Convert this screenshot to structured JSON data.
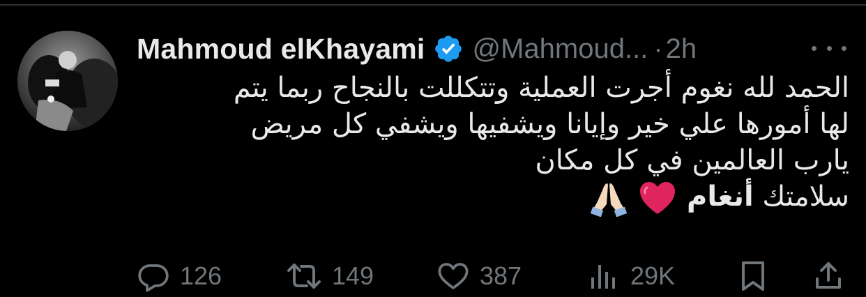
{
  "tweet": {
    "author": {
      "display_name": "Mahmoud elKhayami",
      "handle": "@Mahmoud...",
      "verified": true
    },
    "separator": "·",
    "time": "2h",
    "text_lines": [
      "الحمد لله نغوم أجرت العملية وتتكللت بالنجاح ربما يتم",
      "لها أمورها علي خير وإيانا ويشفيها ويشفي كل مريض",
      "يارب العالمين في كل مكان"
    ],
    "last_line": {
      "prefix": "سلامتك",
      "bold": "أنغام",
      "emojis": [
        "red-heart",
        "folded-hands"
      ]
    },
    "actions": {
      "replies": "126",
      "reposts": "149",
      "likes": "387",
      "views": "29K"
    }
  },
  "colors": {
    "background": "#000000",
    "text": "#e7e9ea",
    "secondary": "#71767b",
    "verified_blue": "#1d9bf0",
    "heart_red": "#e0245e"
  }
}
